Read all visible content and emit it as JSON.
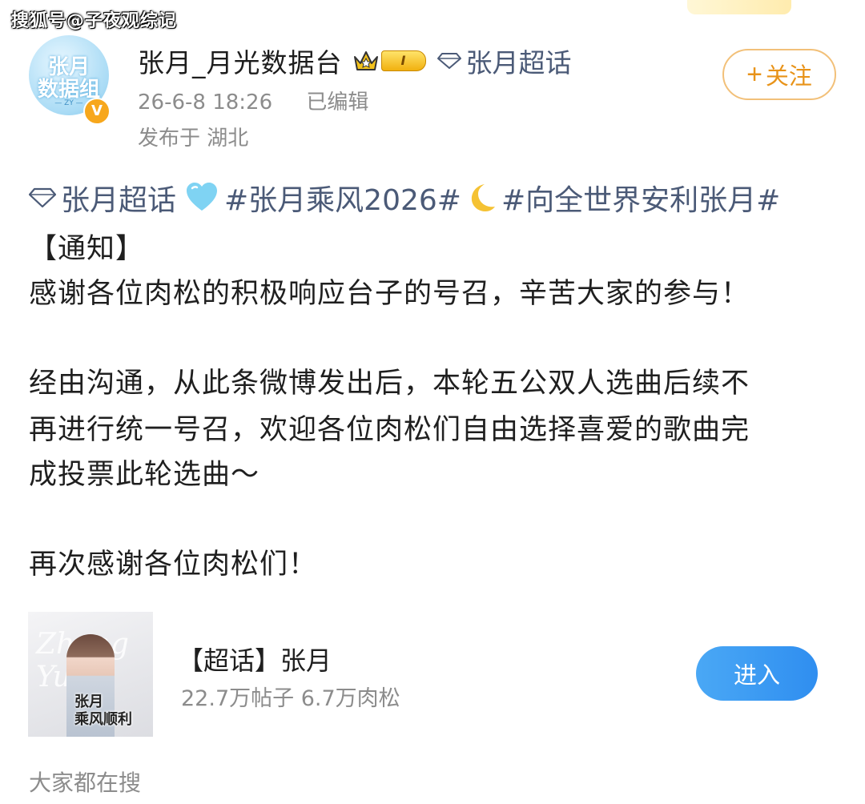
{
  "watermark": "搜狐号@子夜观综记",
  "header": {
    "avatar_text": "张月\n数据组",
    "avatar_sub": "— ZY —",
    "verified_mark": "V",
    "username": "张月_月光数据台",
    "level": "I",
    "supertopic_link": "张月超话",
    "timestamp": "26-6-8 18:26",
    "edited": "已编辑",
    "location": "发布于 湖北",
    "follow_label": "关注"
  },
  "post": {
    "topic": "张月超话",
    "hashtag_1": "#张月乘风2026#",
    "hashtag_2": "#向全世界安利张月#",
    "lines": [
      "【通知】",
      "感谢各位肉松的积极响应台子的号召，辛苦大家的参与！",
      "经由沟通，从此条微博发出后，本轮五公双人选曲后续不",
      "再进行统一号召，欢迎各位肉松们自由选择喜爱的歌曲完",
      "成投票此轮选曲～",
      "再次感谢各位肉松们！"
    ]
  },
  "supertopic_card": {
    "cover_title": "张月\n乘风顺利",
    "cover_deco": "Zhang Yue",
    "title": "【超话】张月",
    "stats": "22.7万帖子 6.7万肉松",
    "enter_label": "进入"
  },
  "footer": {
    "search_hint": "大家都在搜"
  },
  "colors": {
    "accent_orange": "#e89319",
    "link_blue": "#4b5a77",
    "button_blue": "#2f8ef0"
  }
}
